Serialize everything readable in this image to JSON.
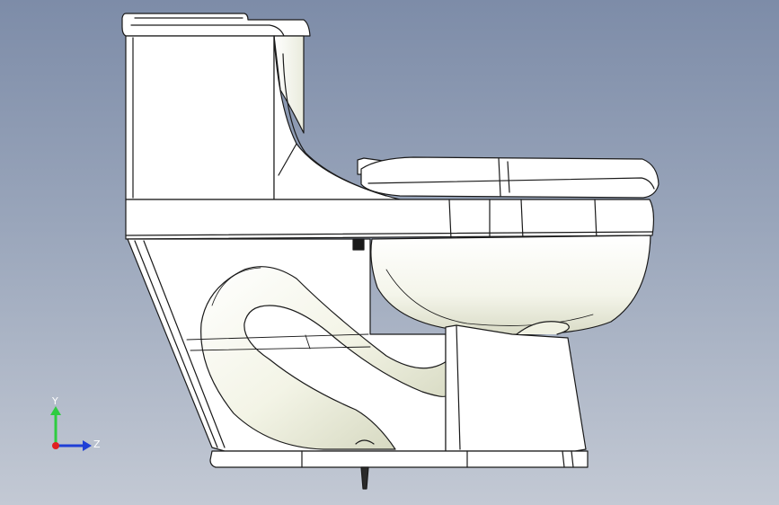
{
  "viewport": {
    "background_top": "#7d8ca8",
    "background_bottom": "#c3c9d4"
  },
  "model": {
    "body_fill": "#ffffff",
    "shade_fill": "#e6e8d8",
    "trapway_fill": "#f2f3e4",
    "outline": "#1a1a1a"
  },
  "triad": {
    "y_label": "Y",
    "z_label": "Z",
    "y_color": "#2ecc40",
    "z_color": "#1f3fd6",
    "x_color": "#e02020"
  }
}
